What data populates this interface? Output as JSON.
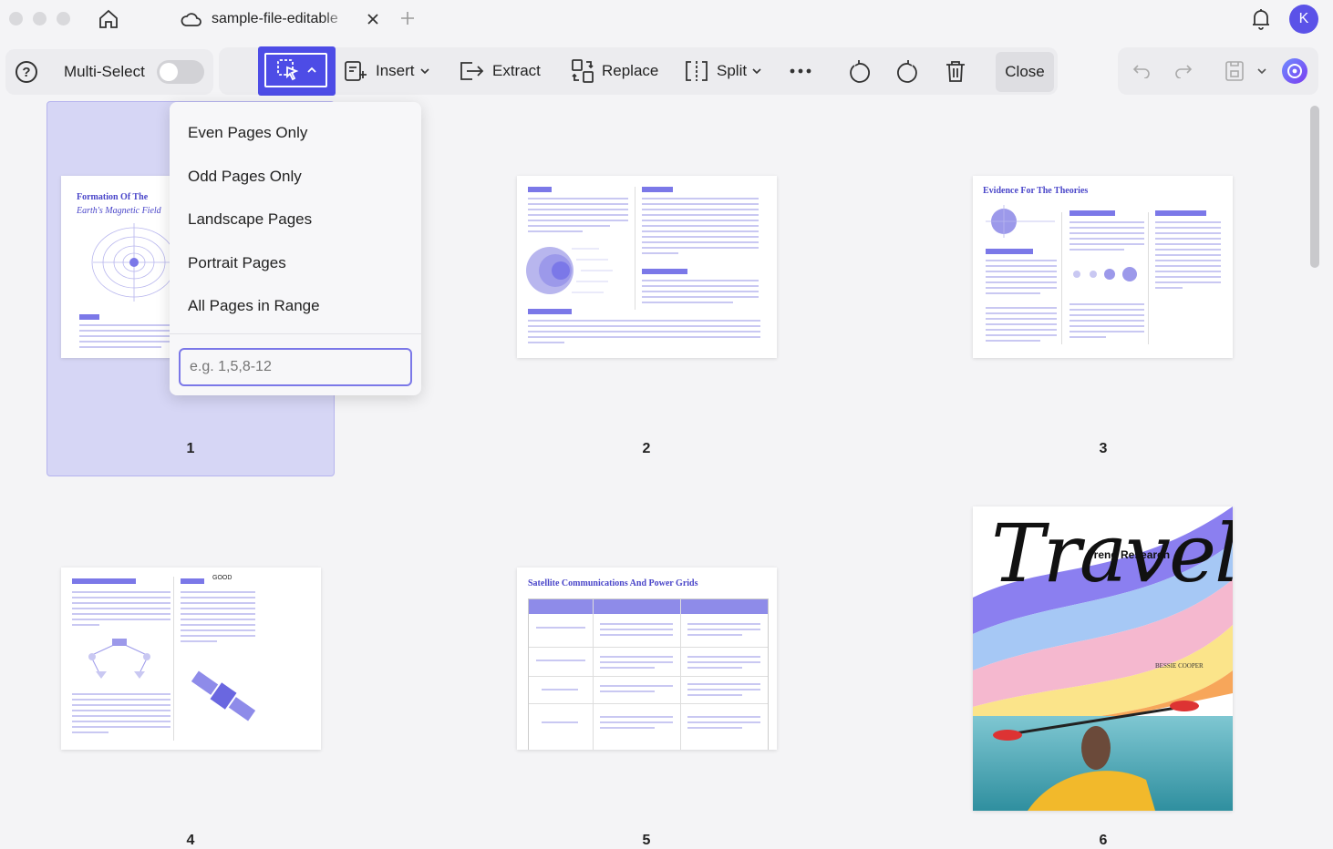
{
  "titlebar": {
    "tab_title": "sample-file-editable",
    "avatar_initial": "K"
  },
  "toolbar": {
    "multi_select_label": "Multi-Select",
    "multi_select_on": false,
    "insert_label": "Insert",
    "extract_label": "Extract",
    "replace_label": "Replace",
    "split_label": "Split",
    "close_label": "Close"
  },
  "dropdown": {
    "items": [
      "Even Pages Only",
      "Odd Pages Only",
      "Landscape Pages",
      "Portrait Pages",
      "All Pages in Range"
    ],
    "range_placeholder": "e.g. 1,5,8-12"
  },
  "pages": [
    {
      "number": "1",
      "title_line1": "Formation Of The",
      "title_line2": "Earth's Magnetic Field",
      "selected": true
    },
    {
      "number": "2"
    },
    {
      "number": "3",
      "title_line1": "Evidence For The Theories"
    },
    {
      "number": "4",
      "tag": "GOOD"
    },
    {
      "number": "5",
      "title_line1": "Satellite Communications And Power Grids"
    },
    {
      "number": "6",
      "title_line1": "Travel",
      "subtitle": "Trend Research",
      "author": "BESSIE COOPER"
    }
  ],
  "colors": {
    "accent": "#4d4ce6",
    "selection_bg": "#d6d6f5"
  }
}
